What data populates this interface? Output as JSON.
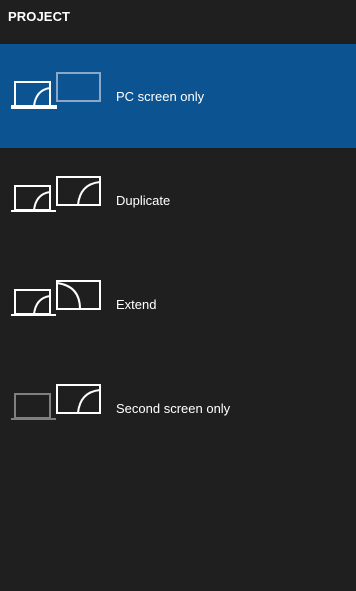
{
  "panel": {
    "title": "PROJECT"
  },
  "options": [
    {
      "label": "PC screen only",
      "icon": "pc-screen-only-icon",
      "selected": true
    },
    {
      "label": "Duplicate",
      "icon": "duplicate-icon",
      "selected": false
    },
    {
      "label": "Extend",
      "icon": "extend-icon",
      "selected": false
    },
    {
      "label": "Second screen only",
      "icon": "second-screen-only-icon",
      "selected": false
    }
  ],
  "colors": {
    "background": "#1f1f1f",
    "selected_background": "#0b5391",
    "icon_active": "#ffffff",
    "icon_dimmed": "#7f7f7f",
    "icon_dimmed_on_selected": "#8aa9c8"
  }
}
